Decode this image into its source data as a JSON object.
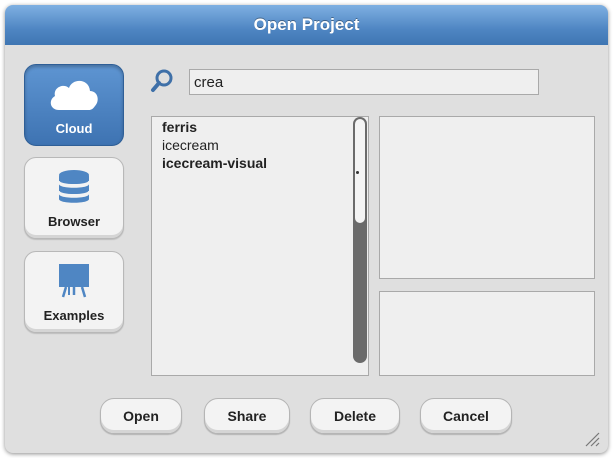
{
  "dialog": {
    "title": "Open Project"
  },
  "sources": [
    {
      "label": "Cloud",
      "icon": "cloud-icon",
      "active": true
    },
    {
      "label": "Browser",
      "icon": "database-icon",
      "active": false
    },
    {
      "label": "Examples",
      "icon": "easel-icon",
      "active": false
    }
  ],
  "search": {
    "value": "crea",
    "icon": "search-icon"
  },
  "projects": [
    {
      "name": "ferris",
      "bold": true
    },
    {
      "name": "icecream",
      "bold": false
    },
    {
      "name": "icecream-visual",
      "bold": true
    }
  ],
  "buttons": {
    "open": "Open",
    "share": "Share",
    "delete": "Delete",
    "cancel": "Cancel"
  },
  "colors": {
    "accent": "#4f86c3",
    "dialog_bg": "#dfdfdf",
    "panel_bg": "#efefef"
  }
}
